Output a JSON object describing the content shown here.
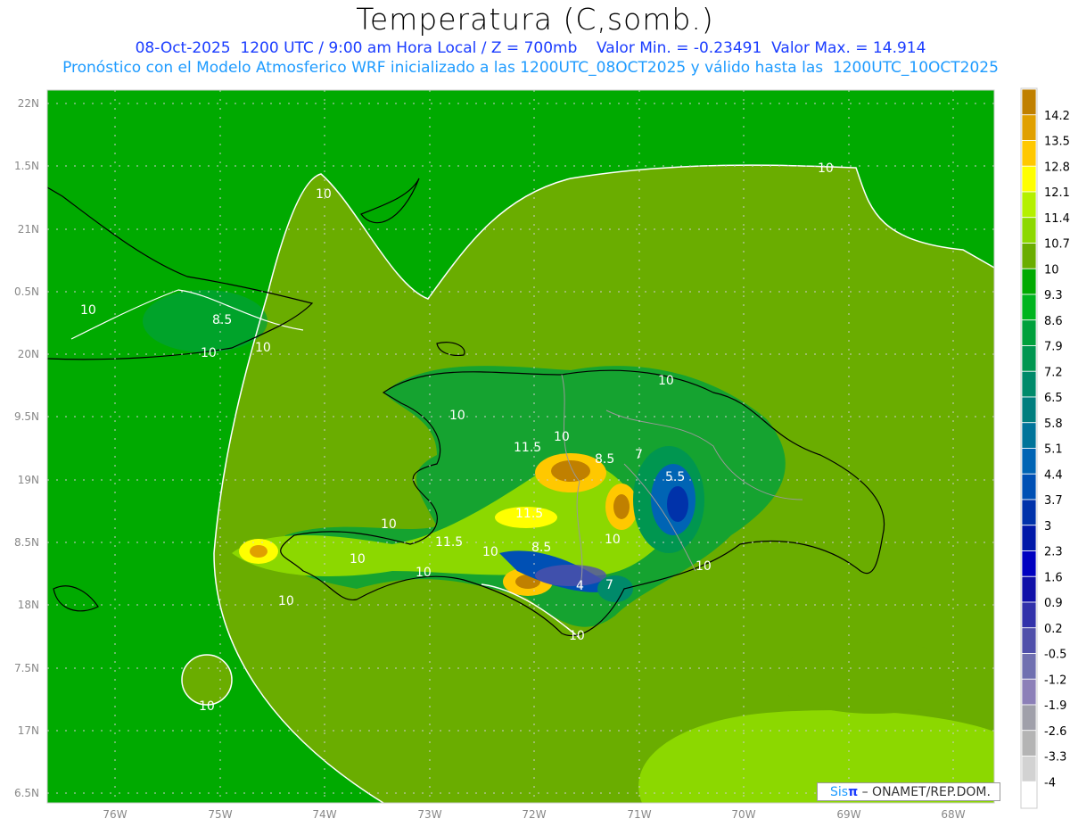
{
  "header": {
    "title": "Temperatura (C,somb.)",
    "subtitle1": "08-Oct-2025  1200 UTC / 9:00 am Hora Local / Z = 700mb    Valor Min. = -0.23491  Valor Max. = 14.914",
    "subtitle2": "Pronóstico con el Modelo Atmosferico WRF inicializado a las 1200UTC_08OCT2025 y válido hasta las  1200UTC_10OCT2025"
  },
  "axes": {
    "lon_labels": [
      "76W",
      "75W",
      "74W",
      "73W",
      "72W",
      "71W",
      "70W",
      "69W",
      "68W"
    ],
    "lat_labels": [
      "22N",
      "1.5N",
      "21N",
      "0.5N",
      "20N",
      "9.5N",
      "19N",
      "8.5N",
      "18N",
      "7.5N",
      "17N",
      "6.5N"
    ]
  },
  "colorbar": {
    "labels": [
      "14.2",
      "13.5",
      "12.8",
      "12.1",
      "11.4",
      "10.7",
      "10",
      "9.3",
      "8.6",
      "7.9",
      "7.2",
      "6.5",
      "5.8",
      "5.1",
      "4.4",
      "3.7",
      "3",
      "2.3",
      "1.6",
      "0.9",
      "0.2",
      "-0.5",
      "-1.2",
      "-1.9",
      "-2.6",
      "-3.3",
      "-4"
    ],
    "colors": [
      "#c08000",
      "#e0a000",
      "#ffc800",
      "#ffff00",
      "#b4f000",
      "#8cd800",
      "#6aad00",
      "#00aa00",
      "#00b41e",
      "#00a03c",
      "#009650",
      "#008a6a",
      "#007e7e",
      "#00749a",
      "#0064b4",
      "#0050b4",
      "#0032aa",
      "#0018a8",
      "#0000c0",
      "#1010a8",
      "#3232aa",
      "#5050aa",
      "#7070b0",
      "#8c80b8",
      "#a0a0aa",
      "#b4b4b4",
      "#d2d2d2",
      "#ffffff"
    ]
  },
  "map": {
    "contour_labels": [
      "10",
      "10",
      "10",
      "8.5",
      "10",
      "10",
      "10",
      "10",
      "11.5",
      "10",
      "8.5",
      "7",
      "5.5",
      "11.5",
      "10",
      "10",
      "11.5",
      "10",
      "10",
      "8.5",
      "4",
      "7",
      "10",
      "10",
      "10",
      "10",
      "10"
    ]
  },
  "footer": {
    "logo_sis": "Sis",
    "logo_pi": "π",
    "logo_text": " – ONAMET/REP.DOM."
  }
}
